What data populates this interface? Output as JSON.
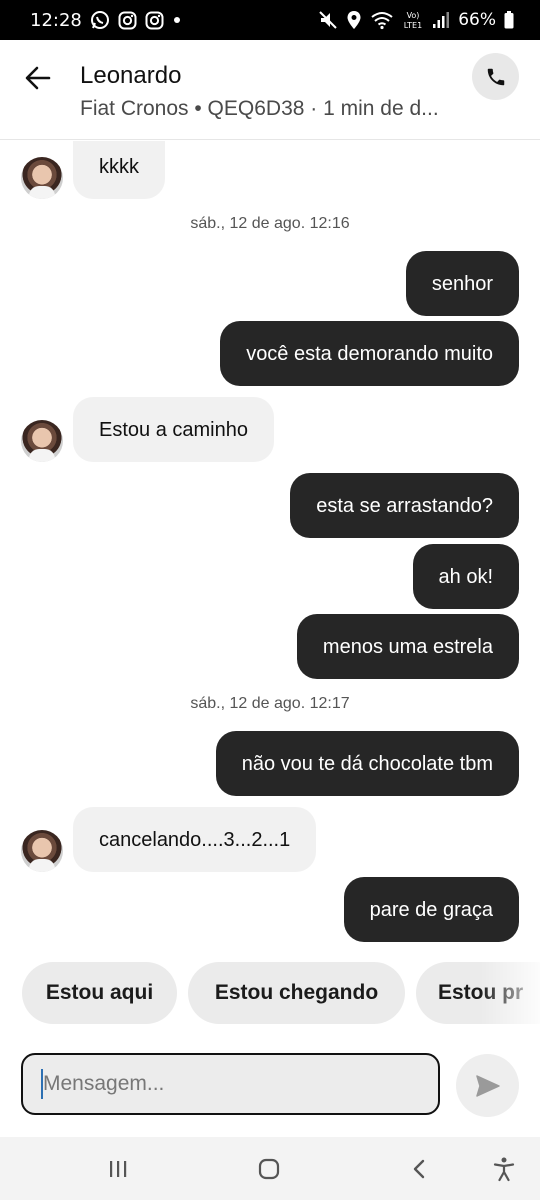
{
  "status_bar": {
    "time": "12:28",
    "left_icons": [
      "whatsapp-icon",
      "instagram-icon",
      "instagram-icon",
      "dot-icon"
    ],
    "right_icons": [
      "mute-icon",
      "location-icon",
      "wifi-icon",
      "volte-icon",
      "signal-icon",
      "battery-icon"
    ],
    "volte_label": "Vo) LTE1",
    "battery": "66%"
  },
  "header": {
    "name": "Leonardo",
    "subtitle": "Fiat Cronos • QEQ6D38 · 1 min de d..."
  },
  "messages": [
    {
      "side": "in",
      "text": "kkkk",
      "avatar": true
    },
    {
      "type": "date",
      "text": "sáb., 12 de ago. 12:16"
    },
    {
      "side": "out",
      "text": "senhor"
    },
    {
      "side": "out",
      "text": "você esta demorando muito"
    },
    {
      "side": "in",
      "text": "Estou a caminho",
      "avatar": true
    },
    {
      "side": "out",
      "text": "esta se arrastando?"
    },
    {
      "side": "out",
      "text": "ah ok!"
    },
    {
      "side": "out",
      "text": "menos uma estrela"
    },
    {
      "type": "date",
      "text": "sáb., 12 de ago. 12:17"
    },
    {
      "side": "out",
      "text": "não vou te dá chocolate tbm"
    },
    {
      "side": "in",
      "text": "cancelando....3...2...1",
      "avatar": true
    },
    {
      "side": "out",
      "text": "pare de graça"
    }
  ],
  "quick_replies": [
    "Estou aqui",
    "Estou chegando",
    "Estou pr"
  ],
  "composer": {
    "placeholder": "Mensagem..."
  },
  "colors": {
    "outgoing_bubble": "#262626",
    "incoming_bubble": "#f1f1f1",
    "chip": "#ebebeb"
  }
}
